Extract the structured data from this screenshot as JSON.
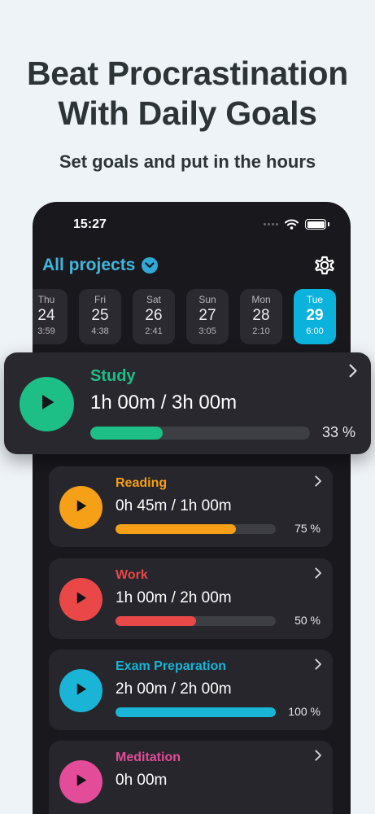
{
  "promo": {
    "headline_line1": "Beat Procrastination",
    "headline_line2": "With Daily Goals",
    "subheadline": "Set goals and put in the hours"
  },
  "status_bar": {
    "time": "15:27"
  },
  "header": {
    "title": "All projects"
  },
  "days": [
    {
      "name": "Thu",
      "num": "24",
      "time": "3:59",
      "active": false
    },
    {
      "name": "Fri",
      "num": "25",
      "time": "4:38",
      "active": false
    },
    {
      "name": "Sat",
      "num": "26",
      "time": "2:41",
      "active": false
    },
    {
      "name": "Sun",
      "num": "27",
      "time": "3:05",
      "active": false
    },
    {
      "name": "Mon",
      "num": "28",
      "time": "2:10",
      "active": false
    },
    {
      "name": "Tue",
      "num": "29",
      "time": "6:00",
      "active": true
    }
  ],
  "projects": [
    {
      "name": "Study",
      "progress_text": "1h 00m / 3h 00m",
      "percent_label": "33 %",
      "progress": 0.33,
      "color": "#1dbf86"
    },
    {
      "name": "Reading",
      "progress_text": "0h 45m / 1h 00m",
      "percent_label": "75 %",
      "progress": 0.75,
      "color": "#f5a017"
    },
    {
      "name": "Work",
      "progress_text": "1h 00m / 2h 00m",
      "percent_label": "50 %",
      "progress": 0.5,
      "color": "#ea4848"
    },
    {
      "name": "Exam Preparation",
      "progress_text": "2h 00m / 2h 00m",
      "percent_label": "100 %",
      "progress": 1.0,
      "color": "#19b4d6"
    },
    {
      "name": "Meditation",
      "progress_text": "0h 00m",
      "percent_label": "",
      "progress": 0,
      "color": "#e34c99"
    }
  ],
  "colors": {
    "accent": "#0ab2dc",
    "header_title": "#3fb6dc",
    "background": "#eef3f7",
    "phone": "#18181d"
  },
  "icons": [
    "wifi-icon",
    "battery-icon",
    "chevron-down-icon",
    "gear-icon",
    "play-icon",
    "chevron-right-icon"
  ]
}
